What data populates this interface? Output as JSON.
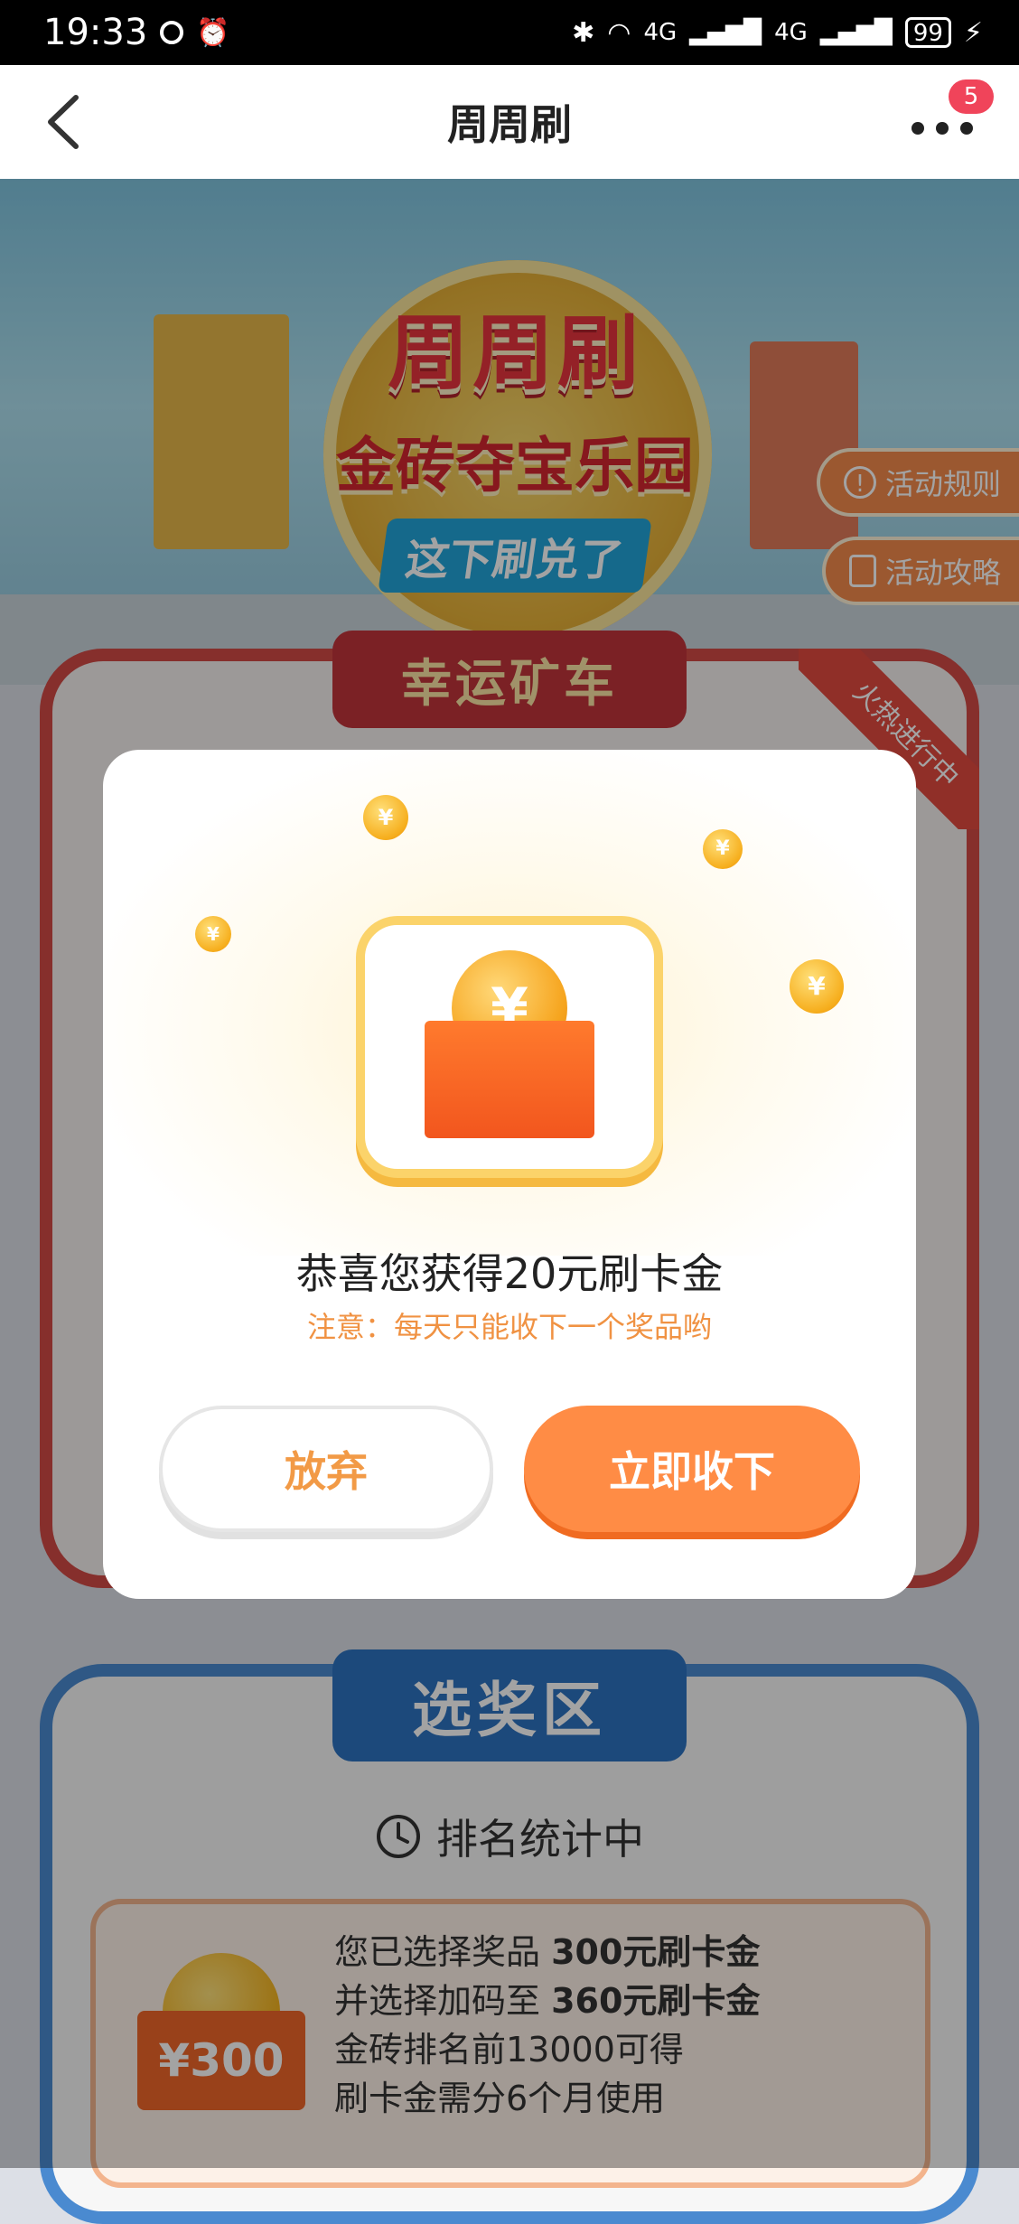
{
  "status_bar": {
    "time": "19:33",
    "network1": "4G",
    "network2": "4G",
    "battery": "99"
  },
  "header": {
    "title": "周周刷",
    "badge_count": "5"
  },
  "banner": {
    "title_line1": "周周刷",
    "title_line2": "金砖夺宝乐园",
    "title_line3": "这下刷兑了",
    "rules_button": "活动规则",
    "guide_button": "活动攻略"
  },
  "lucky_cart": {
    "label": "幸运矿车",
    "ribbon": "火热进行中"
  },
  "modal": {
    "title": "恭喜您获得20元刷卡金",
    "note": "注意：每天只能收下一个奖品哟",
    "giveup_button": "放弃",
    "accept_button": "立即收下",
    "coin_symbol": "¥"
  },
  "prize_zone": {
    "label": "选奖区",
    "ranking_status": "排名统计中",
    "line1_prefix": "您已选择奖品",
    "line1_value": "300元刷卡金",
    "line2_prefix": "并选择加码至",
    "line2_value": "360元刷卡金",
    "line3": "金砖排名前13000可得",
    "line4": "刷卡金需分6个月使用",
    "prize_amount": "¥300"
  },
  "colors": {
    "accent_orange": "#ff8c45",
    "note_orange": "#f09243",
    "panel_red": "#d24a45",
    "panel_blue": "#4a8ad0"
  }
}
